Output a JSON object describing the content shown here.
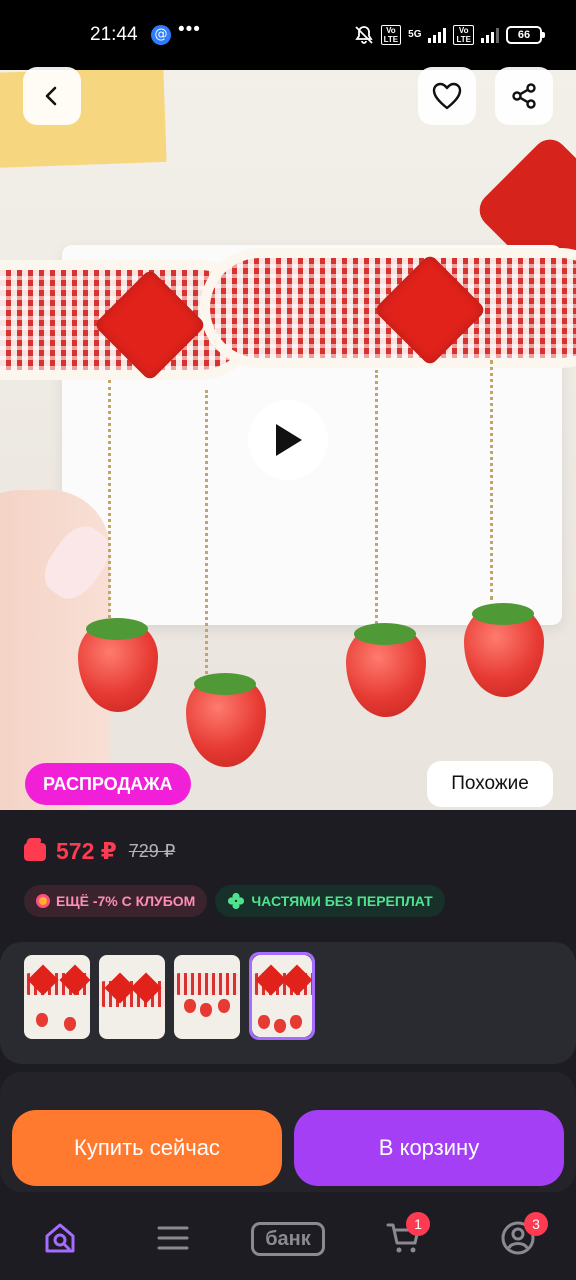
{
  "status_bar": {
    "time": "21:44",
    "network_label": "5G",
    "volte_label": "Vo LTE",
    "battery": "66",
    "icons": [
      "app-notification-icon",
      "more-dots-icon",
      "mute-icon",
      "signal-icon",
      "battery-icon"
    ]
  },
  "product": {
    "sale_badge": "РАСПРОДАЖА",
    "similar_button": "Похожие",
    "price_current": "572 ₽",
    "price_old": "729 ₽",
    "club_chip": "ЕЩЁ -7% С КЛУБОМ",
    "installment_chip": "ЧАСТЯМИ БЕЗ ПЕРЕПЛАТ",
    "thumbnails_count": 4,
    "selected_thumbnail": 4
  },
  "actions": {
    "buy_now": "Купить сейчас",
    "add_to_cart": "В корзину"
  },
  "bottom_nav": {
    "bank_label": "банк",
    "cart_badge": "1",
    "profile_badge": "3"
  },
  "colors": {
    "accent_price": "#ff3b52",
    "sale": "#f21fd9",
    "buy_button": "#ff7a2e",
    "cart_button": "#a43ff5",
    "nav_active": "#a66bff"
  }
}
